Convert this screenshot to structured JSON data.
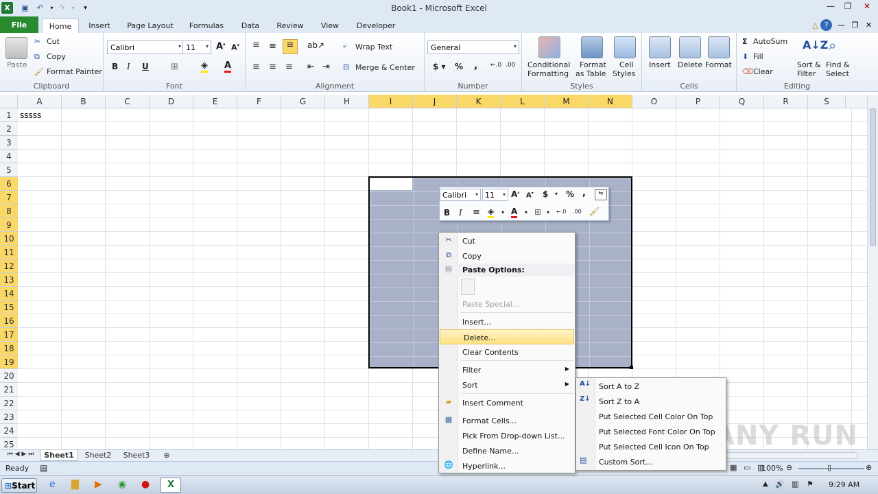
{
  "window": {
    "title": "Book1 - Microsoft Excel"
  },
  "tabs": [
    "File",
    "Home",
    "Insert",
    "Page Layout",
    "Formulas",
    "Data",
    "Review",
    "View",
    "Developer"
  ],
  "ribbon": {
    "clipboard": {
      "paste": "Paste",
      "cut": "Cut",
      "copy": "Copy",
      "format_painter": "Format Painter",
      "label": "Clipboard"
    },
    "font": {
      "name": "Calibri",
      "size": "11",
      "label": "Font"
    },
    "alignment": {
      "wrap": "Wrap Text",
      "merge": "Merge & Center",
      "label": "Alignment"
    },
    "number": {
      "format": "General",
      "label": "Number"
    },
    "styles": {
      "cond1": "Conditional",
      "cond2": "Formatting",
      "fmt1": "Format",
      "fmt2": "as Table",
      "cell1": "Cell",
      "cell2": "Styles",
      "label": "Styles"
    },
    "cells": {
      "insert": "Insert",
      "delete": "Delete",
      "format": "Format",
      "label": "Cells"
    },
    "editing": {
      "autosum": "AutoSum",
      "fill": "Fill",
      "clear": "Clear",
      "sort1": "Sort &",
      "sort2": "Filter",
      "find1": "Find &",
      "find2": "Select",
      "label": "Editing"
    }
  },
  "grid": {
    "columns": [
      "A",
      "B",
      "C",
      "D",
      "E",
      "F",
      "G",
      "H",
      "I",
      "J",
      "K",
      "L",
      "M",
      "N",
      "O",
      "P",
      "Q",
      "R",
      "S"
    ],
    "rows": [
      "1",
      "2",
      "3",
      "4",
      "5",
      "6",
      "7",
      "8",
      "9",
      "10",
      "11",
      "12",
      "13",
      "14",
      "15",
      "16",
      "17",
      "18",
      "19",
      "20",
      "21",
      "22",
      "23",
      "24",
      "25"
    ],
    "a1_value": "sssss"
  },
  "mini_toolbar": {
    "font": "Calibri",
    "size": "11"
  },
  "context_menu": {
    "cut": "Cut",
    "copy": "Copy",
    "paste_options": "Paste Options:",
    "paste_special": "Paste Special...",
    "insert": "Insert...",
    "delete": "Delete...",
    "clear": "Clear Contents",
    "filter": "Filter",
    "sort": "Sort",
    "insert_comment": "Insert Comment",
    "format_cells": "Format Cells...",
    "pick_list": "Pick From Drop-down List...",
    "define_name": "Define Name...",
    "hyperlink": "Hyperlink..."
  },
  "sort_submenu": [
    "Sort A to Z",
    "Sort Z to A",
    "Put Selected Cell Color On Top",
    "Put Selected Font Color On Top",
    "Put Selected Cell Icon On Top",
    "Custom Sort..."
  ],
  "sheets": [
    "Sheet1",
    "Sheet2",
    "Sheet3"
  ],
  "status": {
    "ready": "Ready",
    "zoom": "100%"
  },
  "taskbar": {
    "start": "Start",
    "time": "9:29 AM"
  },
  "watermark": "ANY RUN",
  "colors": {
    "file_tab": "#2a8a2f",
    "selection": "#a9b1c9",
    "header_highlight": "#f9d867",
    "menu_highlight": "#fde285"
  }
}
